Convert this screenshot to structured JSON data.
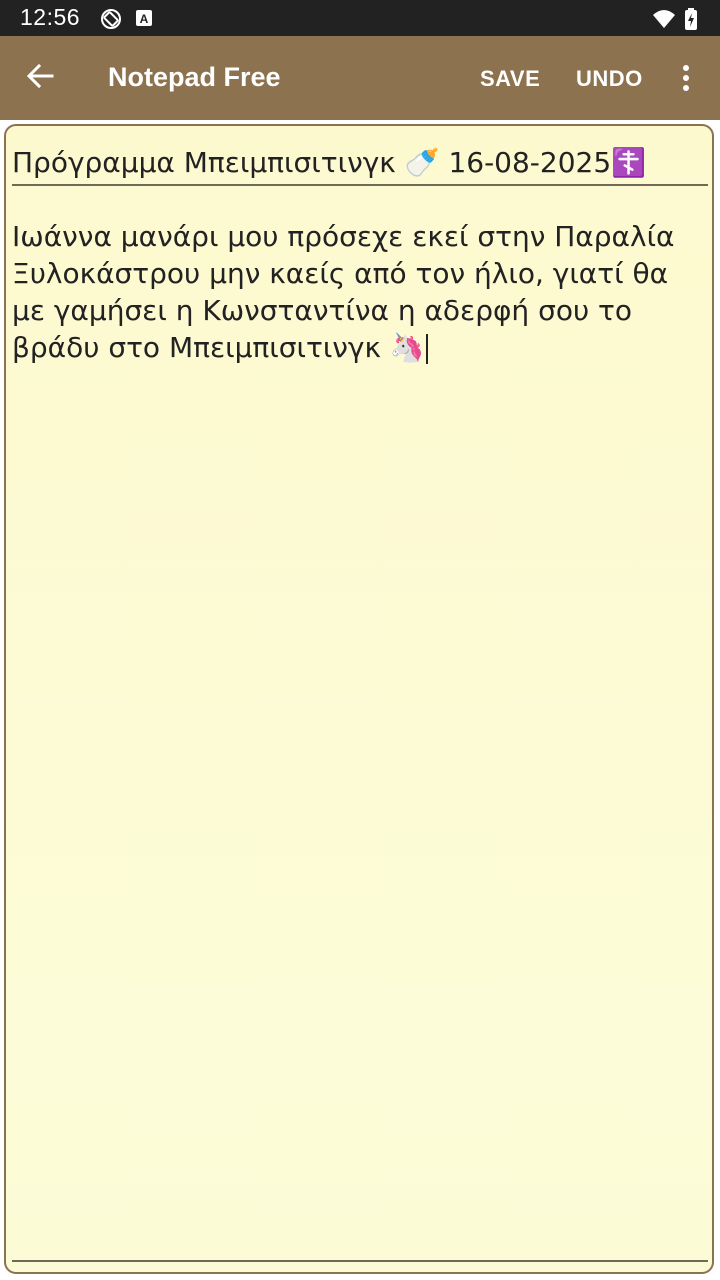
{
  "status_bar": {
    "time": "12:56",
    "icons": [
      "screen-rotation-icon",
      "a-notification-icon",
      "wifi-icon",
      "battery-icon"
    ]
  },
  "app_bar": {
    "title": "Notepad Free",
    "back_icon": "back-arrow-icon",
    "save_label": "SAVE",
    "undo_label": "UNDO",
    "overflow_icon": "more-vertical-icon"
  },
  "note": {
    "title": "Πρόγραμμα Μπειμπισιτινγκ 🍼 16-08-2025☦️",
    "body": "Ιωάννα μανάρι μου πρόσεχε εκεί στην Παραλία Ξυλοκάστρου μην καείς από τον ήλιο, γιατί θα με γαμήσει η Κωνσταντίνα η αδερφή σου το βράδυ στο Μπειμπισιτινγκ 🦄"
  },
  "colors": {
    "app_bar": "#8c724f",
    "status_bar": "#222222",
    "paper": "#fdf9cf",
    "text": "#222222",
    "rule": "#6e6a57"
  }
}
